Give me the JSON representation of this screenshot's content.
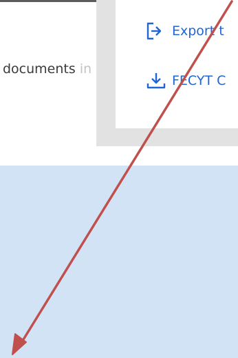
{
  "left_panel": {
    "documents_label": "documents",
    "documents_suffix": "in"
  },
  "export_menu": {
    "items": [
      {
        "label": "Export t",
        "icon": "export-icon"
      },
      {
        "label": "FECYT C",
        "icon": "download-icon"
      }
    ]
  },
  "colors": {
    "link_blue": "#1f66d4",
    "highlight_blue": "#d3e3f6",
    "annotation_red": "#c0504d",
    "menu_shadow": "#e2e2e2"
  }
}
